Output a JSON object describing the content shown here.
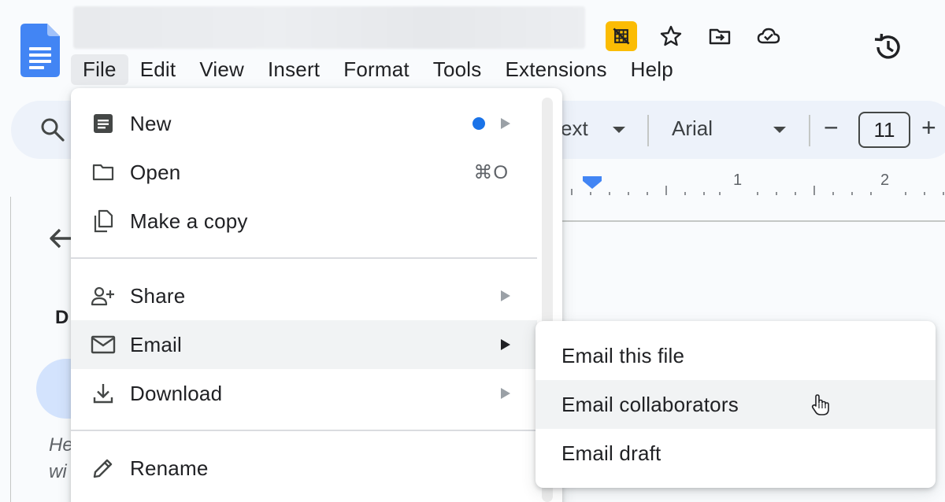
{
  "app": {
    "title": "",
    "menubar": [
      "File",
      "Edit",
      "View",
      "Insert",
      "Format",
      "Tools",
      "Extensions",
      "Help"
    ],
    "active_menu": "File"
  },
  "toolbar": {
    "style_partial": "ext",
    "font": "Arial",
    "font_size": "11",
    "minus": "−",
    "plus": "+"
  },
  "ruler": {
    "marks": [
      "1",
      "2"
    ]
  },
  "side_panel": {
    "letter": "D",
    "italic_1": "He",
    "italic_2": "wi"
  },
  "file_menu": {
    "items": [
      {
        "label": "New",
        "icon": "new-doc-icon",
        "has_submenu": true,
        "has_dot": true
      },
      {
        "label": "Open",
        "icon": "folder-icon",
        "shortcut": "⌘O"
      },
      {
        "label": "Make a copy",
        "icon": "copy-icon"
      },
      {
        "label": "Share",
        "icon": "add-person-icon",
        "has_submenu": true
      },
      {
        "label": "Email",
        "icon": "mail-icon",
        "has_submenu": true,
        "highlighted": true
      },
      {
        "label": "Download",
        "icon": "download-icon",
        "has_submenu": true
      },
      {
        "label": "Rename",
        "icon": "pencil-icon"
      }
    ]
  },
  "email_submenu": {
    "items": [
      {
        "label": "Email this file"
      },
      {
        "label": "Email collaborators",
        "hovered": true
      },
      {
        "label": "Email draft"
      }
    ]
  },
  "colors": {
    "accent_blue": "#1a73e8",
    "docs_blue": "#4285f4",
    "badge_yellow": "#fbbc04",
    "toolbar_bg": "#edf2fa",
    "menu_highlight": "#f1f3f4"
  }
}
